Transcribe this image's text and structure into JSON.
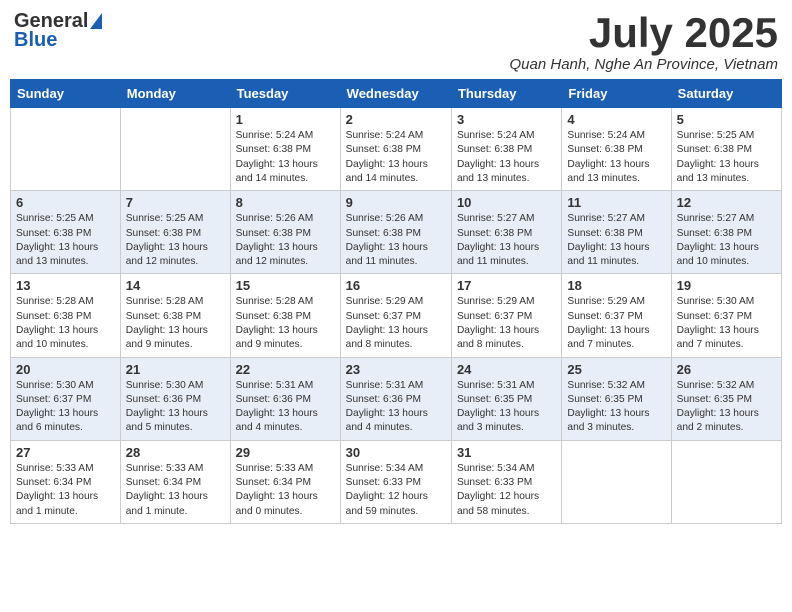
{
  "header": {
    "logo_general": "General",
    "logo_blue": "Blue",
    "title": "July 2025",
    "subtitle": "Quan Hanh, Nghe An Province, Vietnam"
  },
  "days_of_week": [
    "Sunday",
    "Monday",
    "Tuesday",
    "Wednesday",
    "Thursday",
    "Friday",
    "Saturday"
  ],
  "weeks": [
    {
      "days": [
        {
          "num": "",
          "info": ""
        },
        {
          "num": "",
          "info": ""
        },
        {
          "num": "1",
          "info": "Sunrise: 5:24 AM\nSunset: 6:38 PM\nDaylight: 13 hours and 14 minutes."
        },
        {
          "num": "2",
          "info": "Sunrise: 5:24 AM\nSunset: 6:38 PM\nDaylight: 13 hours and 14 minutes."
        },
        {
          "num": "3",
          "info": "Sunrise: 5:24 AM\nSunset: 6:38 PM\nDaylight: 13 hours and 13 minutes."
        },
        {
          "num": "4",
          "info": "Sunrise: 5:24 AM\nSunset: 6:38 PM\nDaylight: 13 hours and 13 minutes."
        },
        {
          "num": "5",
          "info": "Sunrise: 5:25 AM\nSunset: 6:38 PM\nDaylight: 13 hours and 13 minutes."
        }
      ]
    },
    {
      "days": [
        {
          "num": "6",
          "info": "Sunrise: 5:25 AM\nSunset: 6:38 PM\nDaylight: 13 hours and 13 minutes."
        },
        {
          "num": "7",
          "info": "Sunrise: 5:25 AM\nSunset: 6:38 PM\nDaylight: 13 hours and 12 minutes."
        },
        {
          "num": "8",
          "info": "Sunrise: 5:26 AM\nSunset: 6:38 PM\nDaylight: 13 hours and 12 minutes."
        },
        {
          "num": "9",
          "info": "Sunrise: 5:26 AM\nSunset: 6:38 PM\nDaylight: 13 hours and 11 minutes."
        },
        {
          "num": "10",
          "info": "Sunrise: 5:27 AM\nSunset: 6:38 PM\nDaylight: 13 hours and 11 minutes."
        },
        {
          "num": "11",
          "info": "Sunrise: 5:27 AM\nSunset: 6:38 PM\nDaylight: 13 hours and 11 minutes."
        },
        {
          "num": "12",
          "info": "Sunrise: 5:27 AM\nSunset: 6:38 PM\nDaylight: 13 hours and 10 minutes."
        }
      ]
    },
    {
      "days": [
        {
          "num": "13",
          "info": "Sunrise: 5:28 AM\nSunset: 6:38 PM\nDaylight: 13 hours and 10 minutes."
        },
        {
          "num": "14",
          "info": "Sunrise: 5:28 AM\nSunset: 6:38 PM\nDaylight: 13 hours and 9 minutes."
        },
        {
          "num": "15",
          "info": "Sunrise: 5:28 AM\nSunset: 6:38 PM\nDaylight: 13 hours and 9 minutes."
        },
        {
          "num": "16",
          "info": "Sunrise: 5:29 AM\nSunset: 6:37 PM\nDaylight: 13 hours and 8 minutes."
        },
        {
          "num": "17",
          "info": "Sunrise: 5:29 AM\nSunset: 6:37 PM\nDaylight: 13 hours and 8 minutes."
        },
        {
          "num": "18",
          "info": "Sunrise: 5:29 AM\nSunset: 6:37 PM\nDaylight: 13 hours and 7 minutes."
        },
        {
          "num": "19",
          "info": "Sunrise: 5:30 AM\nSunset: 6:37 PM\nDaylight: 13 hours and 7 minutes."
        }
      ]
    },
    {
      "days": [
        {
          "num": "20",
          "info": "Sunrise: 5:30 AM\nSunset: 6:37 PM\nDaylight: 13 hours and 6 minutes."
        },
        {
          "num": "21",
          "info": "Sunrise: 5:30 AM\nSunset: 6:36 PM\nDaylight: 13 hours and 5 minutes."
        },
        {
          "num": "22",
          "info": "Sunrise: 5:31 AM\nSunset: 6:36 PM\nDaylight: 13 hours and 4 minutes."
        },
        {
          "num": "23",
          "info": "Sunrise: 5:31 AM\nSunset: 6:36 PM\nDaylight: 13 hours and 4 minutes."
        },
        {
          "num": "24",
          "info": "Sunrise: 5:31 AM\nSunset: 6:35 PM\nDaylight: 13 hours and 3 minutes."
        },
        {
          "num": "25",
          "info": "Sunrise: 5:32 AM\nSunset: 6:35 PM\nDaylight: 13 hours and 3 minutes."
        },
        {
          "num": "26",
          "info": "Sunrise: 5:32 AM\nSunset: 6:35 PM\nDaylight: 13 hours and 2 minutes."
        }
      ]
    },
    {
      "days": [
        {
          "num": "27",
          "info": "Sunrise: 5:33 AM\nSunset: 6:34 PM\nDaylight: 13 hours and 1 minute."
        },
        {
          "num": "28",
          "info": "Sunrise: 5:33 AM\nSunset: 6:34 PM\nDaylight: 13 hours and 1 minute."
        },
        {
          "num": "29",
          "info": "Sunrise: 5:33 AM\nSunset: 6:34 PM\nDaylight: 13 hours and 0 minutes."
        },
        {
          "num": "30",
          "info": "Sunrise: 5:34 AM\nSunset: 6:33 PM\nDaylight: 12 hours and 59 minutes."
        },
        {
          "num": "31",
          "info": "Sunrise: 5:34 AM\nSunset: 6:33 PM\nDaylight: 12 hours and 58 minutes."
        },
        {
          "num": "",
          "info": ""
        },
        {
          "num": "",
          "info": ""
        }
      ]
    }
  ]
}
